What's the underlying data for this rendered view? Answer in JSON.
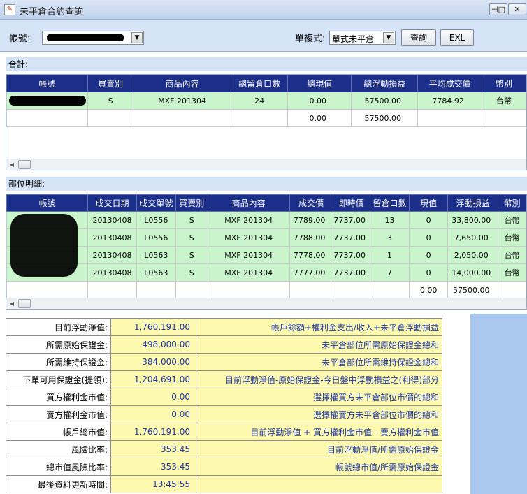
{
  "window": {
    "title": "未平倉合約查詢",
    "pin_glyph": "⊣□"
  },
  "toolbar": {
    "account_label": "帳號:",
    "mode_label": "單複式:",
    "mode_value": "單式未平倉",
    "query_button": "查詢",
    "excel_button": "EXL"
  },
  "totals": {
    "section_label": "合計:",
    "columns": [
      "帳號",
      "買賣別",
      "商品內容",
      "總留倉口數",
      "總現值",
      "總浮動損益",
      "平均成交價",
      "幣別"
    ],
    "rows": [
      [
        "",
        "S",
        "MXF 201304",
        "24",
        "0.00",
        "57500.00",
        "7784.92",
        "台幣"
      ],
      [
        "",
        "",
        "",
        "",
        "0.00",
        "57500.00",
        "",
        ""
      ]
    ]
  },
  "details": {
    "section_label": "部位明細:",
    "columns": [
      "帳號",
      "成交日期",
      "成交單號",
      "買賣別",
      "商品內容",
      "成交價",
      "即時價",
      "留倉口數",
      "現值",
      "浮動損益",
      "幣別"
    ],
    "rows": [
      [
        "",
        "20130408",
        "L0556",
        "S",
        "MXF 201304",
        "7789.00",
        "7737.00",
        "13",
        "0",
        "33,800.00",
        "台幣"
      ],
      [
        "",
        "20130408",
        "L0556",
        "S",
        "MXF 201304",
        "7788.00",
        "7737.00",
        "3",
        "0",
        "7,650.00",
        "台幣"
      ],
      [
        "",
        "20130408",
        "L0563",
        "S",
        "MXF 201304",
        "7778.00",
        "7737.00",
        "1",
        "0",
        "2,050.00",
        "台幣"
      ],
      [
        "",
        "20130408",
        "L0563",
        "S",
        "MXF 201304",
        "7777.00",
        "7737.00",
        "7",
        "0",
        "14,000.00",
        "台幣"
      ],
      [
        "",
        "",
        "",
        "",
        "",
        "",
        "",
        "",
        "0.00",
        "57500.00",
        ""
      ]
    ]
  },
  "summary": [
    {
      "label": "目前浮動淨值:",
      "value": "1,760,191.00",
      "desc": "帳戶餘額+權利金支出/收入+未平倉浮動損益"
    },
    {
      "label": "所需原始保證金:",
      "value": "498,000.00",
      "desc": "未平倉部位所需原始保證金總和"
    },
    {
      "label": "所需維持保證金:",
      "value": "384,000.00",
      "desc": "未平倉部位所需維持保證金總和"
    },
    {
      "label": "下單可用保證金(提領):",
      "value": "1,204,691.00",
      "desc": "目前浮動淨值-原始保證金-今日盤中浮動損益之(利得)部分"
    },
    {
      "label": "買方權利金市值:",
      "value": "0.00",
      "desc": "選擇權買方未平倉部位市價的總和"
    },
    {
      "label": "賣方權利金市值:",
      "value": "0.00",
      "desc": "選擇權賣方未平倉部位市價的總和"
    },
    {
      "label": "帳戶總市值:",
      "value": "1,760,191.00",
      "desc": "目前浮動淨值 + 買方權利金市值 - 賣方權利金市值"
    },
    {
      "label": "風險比率:",
      "value": "353.45",
      "desc": "目前浮動淨值/所需原始保證金"
    },
    {
      "label": "總市值風險比率:",
      "value": "353.45",
      "desc": "帳號總市值/所需原始保證金"
    },
    {
      "label": "最後資料更新時間:",
      "value": "13:45:55",
      "desc": ""
    }
  ]
}
